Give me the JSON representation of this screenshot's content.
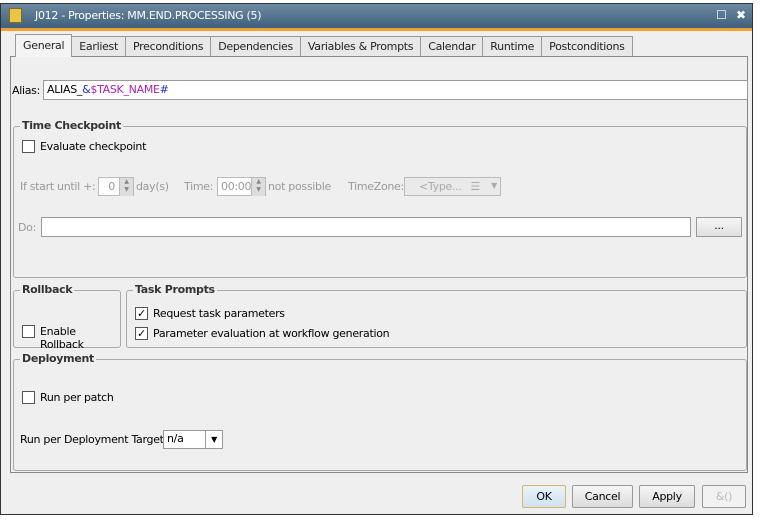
{
  "window": {
    "title": "J012 - Properties: MM.END.PROCESSING (5)",
    "maximize": "☐",
    "close": "✖"
  },
  "tabs": [
    "General",
    "Earliest",
    "Preconditions",
    "Dependencies",
    "Variables & Prompts",
    "Calendar",
    "Runtime",
    "Postconditions"
  ],
  "alias": {
    "label": "Alias:",
    "prefix": "ALIAS_",
    "amp": "&",
    "var": "$TASK_NAME",
    "hash": "#"
  },
  "time_checkpoint": {
    "title": "Time Checkpoint",
    "evaluate_label": "Evaluate checkpoint",
    "evaluate_checked": false,
    "if_start_label": "If start until +:",
    "days_value": "0",
    "days_unit": "day(s)",
    "time_label": "Time:",
    "time_value": "00:00",
    "not_possible": "not possible",
    "timezone_label": "TimeZone:",
    "timezone_placeholder": "<Type...",
    "do_label": "Do:",
    "do_value": "",
    "browse_label": "..."
  },
  "rollback": {
    "title": "Rollback",
    "enable_label": "Enable Rollback",
    "enable_checked": false
  },
  "task_prompts": {
    "title": "Task Prompts",
    "request_label": "Request task parameters",
    "request_checked": true,
    "evaluation_label": "Parameter evaluation at workflow generation",
    "evaluation_checked": true
  },
  "deployment": {
    "title": "Deployment",
    "run_per_patch_label": "Run per patch",
    "run_per_patch_checked": false,
    "target_label": "Run per Deployment Target:",
    "target_value": "n/a"
  },
  "buttons": {
    "ok": "OK",
    "cancel": "Cancel",
    "apply": "Apply",
    "extra": "&()"
  }
}
